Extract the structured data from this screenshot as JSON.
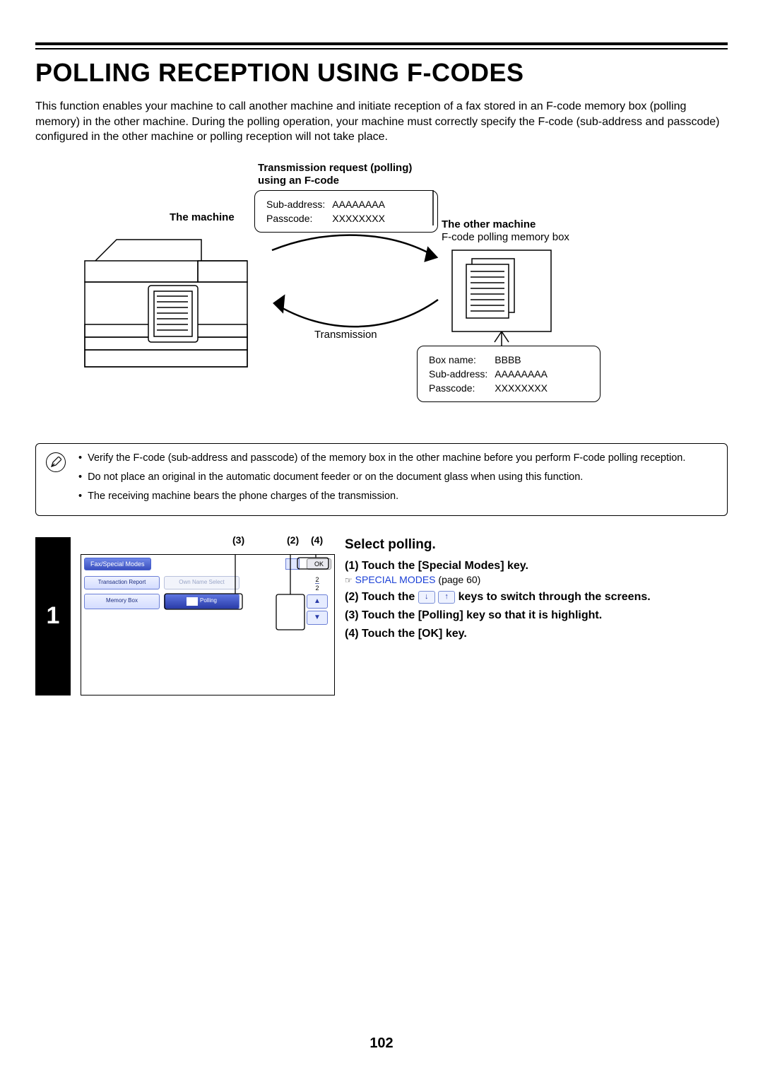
{
  "title": "POLLING RECEPTION USING F-CODES",
  "intro": "This function enables your machine to call another machine and initiate reception of a fax stored in an F-code memory box (polling memory) in the other machine. During the polling operation, your machine must correctly specify the F-code (sub-address and passcode) configured in the other machine or polling reception will not take place.",
  "diagram": {
    "request_label_1": "Transmission request (polling)",
    "request_label_2": "using an F-code",
    "machine_label": "The machine",
    "other_label": "The other machine",
    "other_sub": "F-code polling memory box",
    "transmission_label": "Transmission",
    "req_box": {
      "sub_addr_label": "Sub-address:",
      "sub_addr_val": "AAAAAAAA",
      "passcode_label": "Passcode:",
      "passcode_val": "XXXXXXXX"
    },
    "dest_box": {
      "box_name_label": "Box name:",
      "box_name_val": "BBBB",
      "sub_addr_label": "Sub-address:",
      "sub_addr_val": "AAAAAAAA",
      "passcode_label": "Passcode:",
      "passcode_val": "XXXXXXXX"
    }
  },
  "notes": [
    "Verify the F-code (sub-address and passcode) of the memory box in the other machine before you perform F-code polling reception.",
    "Do not place an original in the automatic document feeder or on the document glass when using this function.",
    "The receiving machine bears the phone charges of the transmission."
  ],
  "step": {
    "number": "1",
    "callouts": {
      "c2": "(2)",
      "c3": "(3)",
      "c4": "(4)"
    },
    "screen": {
      "tab_title": "Fax/Special Modes",
      "ok": "OK",
      "btn_transaction": "Transaction\nReport",
      "btn_own": "Own Name\nSelect",
      "btn_memory": "Memory Box",
      "btn_polling": "Polling",
      "counter_top": "2",
      "counter_bot": "2"
    },
    "instructions": {
      "heading": "Select polling.",
      "items": [
        {
          "num": "(1)",
          "text": "Touch the [Special Modes] key."
        },
        {
          "num": "(2)",
          "text_a": "Touch the ",
          "text_b": " keys to switch through the screens."
        },
        {
          "num": "(3)",
          "text": "Touch the [Polling] key so that it is highlight."
        },
        {
          "num": "(4)",
          "text": "Touch the [OK] key."
        }
      ],
      "link_text": "SPECIAL MODES",
      "link_page": " (page 60)"
    }
  },
  "page_number": "102"
}
